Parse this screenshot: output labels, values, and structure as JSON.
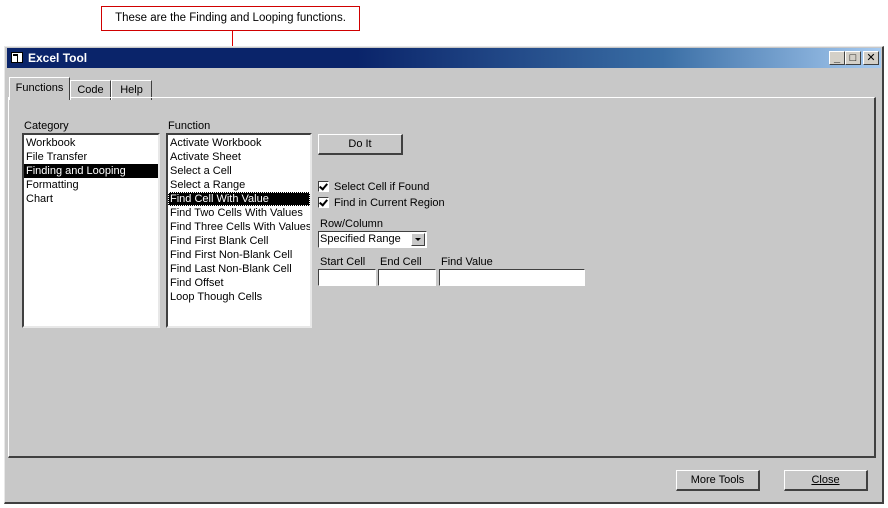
{
  "annotation": {
    "callout_text": "These are the Finding and Looping functions."
  },
  "window": {
    "title": "Excel Tool",
    "controls": {
      "minimize": "_",
      "maximize": "□",
      "close": "✕"
    }
  },
  "tabs": [
    {
      "label": "Functions",
      "active": true
    },
    {
      "label": "Code",
      "active": false
    },
    {
      "label": "Help",
      "active": false
    }
  ],
  "category": {
    "label": "Category",
    "items": [
      "Workbook",
      "File Transfer",
      "Finding and Looping",
      "Formatting",
      "Chart"
    ],
    "selected": "Finding and Looping"
  },
  "function": {
    "label": "Function",
    "items": [
      "Activate Workbook",
      "Activate Sheet",
      "Select a Cell",
      "Select a Range",
      "Find Cell With Value",
      "Find Two Cells With Values",
      "Find Three Cells With Values",
      "Find First Blank Cell",
      "Find First Non-Blank Cell",
      "Find Last Non-Blank Cell",
      "Find Offset",
      "Loop Though Cells"
    ],
    "selected": "Find Cell With Value"
  },
  "options": {
    "do_it_label": "Do It",
    "select_cell_if_found": {
      "label": "Select Cell if Found",
      "checked": true
    },
    "find_in_current_region": {
      "label": "Find in Current Region",
      "checked": true
    },
    "row_column": {
      "label": "Row/Column",
      "value": "Specified Range"
    },
    "start_cell": {
      "label": "Start Cell",
      "value": ""
    },
    "end_cell": {
      "label": "End Cell",
      "value": ""
    },
    "find_value": {
      "label": "Find Value",
      "value": ""
    }
  },
  "footer": {
    "more_tools_label": "More Tools",
    "close_label": "Close"
  }
}
